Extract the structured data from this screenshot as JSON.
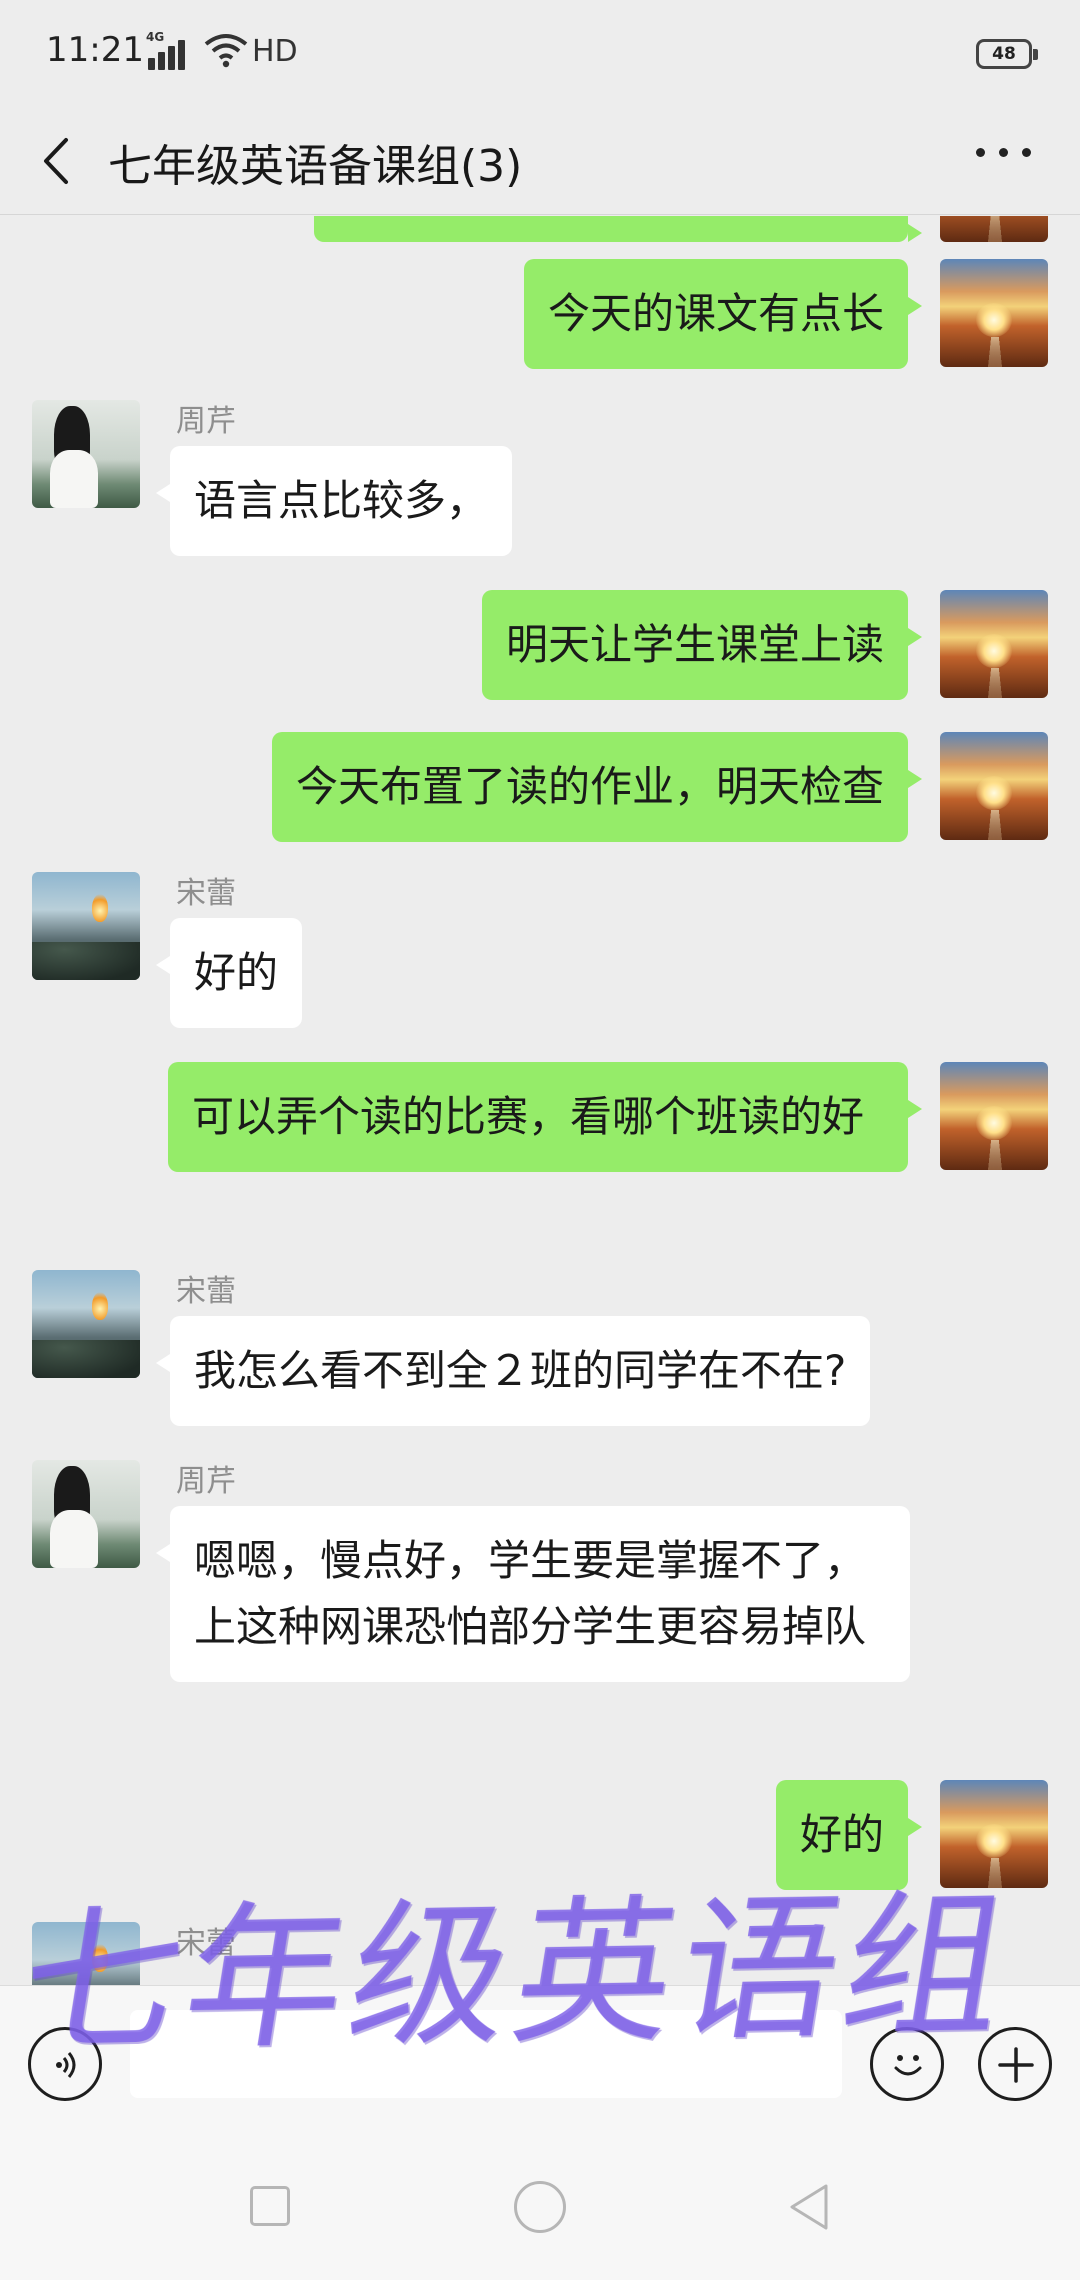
{
  "status_bar": {
    "time": "11:21",
    "network": "4G",
    "label_hd": "HD",
    "battery": "48"
  },
  "title_bar": {
    "title": "七年级英语备课组(3)",
    "back_icon": "chevron-left-icon",
    "more_icon": "more-dots-icon"
  },
  "messages": [
    {
      "side": "out",
      "sender": "",
      "text": ""
    },
    {
      "side": "out",
      "sender": "",
      "text": "今天的课文有点长"
    },
    {
      "side": "in",
      "sender": "周芹",
      "text": "语言点比较多，"
    },
    {
      "side": "out",
      "sender": "",
      "text": "明天让学生课堂上读"
    },
    {
      "side": "out",
      "sender": "",
      "text": "今天布置了读的作业，明天检查"
    },
    {
      "side": "in",
      "sender": "宋蕾",
      "text": "好的"
    },
    {
      "side": "out",
      "sender": "",
      "text": "可以弄个读的比赛，看哪个班读的好"
    },
    {
      "side": "in",
      "sender": "宋蕾",
      "text": "我怎么看不到全２班的同学在不在?"
    },
    {
      "side": "in",
      "sender": "周芹",
      "text": "嗯嗯，慢点好，学生要是掌握不了，上这种网课恐怕部分学生更容易掉队"
    },
    {
      "side": "out",
      "sender": "",
      "text": "好的"
    },
    {
      "side": "in",
      "sender": "宋蕾",
      "text": ""
    }
  ],
  "watermark": "七年级英语组",
  "input_bar": {
    "voice_icon": "voice-icon",
    "emoji_icon": "emoji-icon",
    "plus_icon": "plus-icon",
    "text": ""
  },
  "nav_bar": {
    "icons": [
      "recent-apps-icon",
      "home-icon",
      "back-icon"
    ]
  },
  "colors": {
    "background": "#ededed",
    "outgoing_bubble": "#95ec69",
    "incoming_bubble": "#ffffff",
    "watermark": "#7e60e8"
  }
}
